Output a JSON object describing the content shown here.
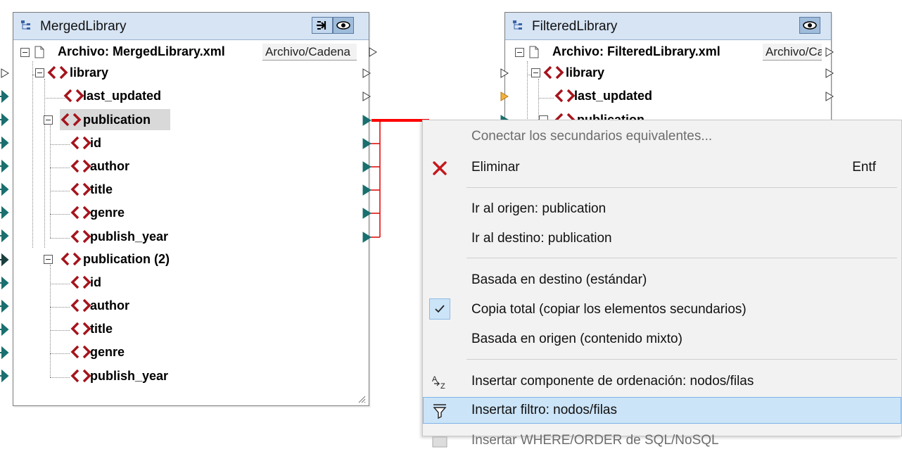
{
  "left_component": {
    "title": "MergedLibrary",
    "file_label": "Archivo: MergedLibrary.xml",
    "mode_label": "Archivo/Cadena",
    "nodes": [
      {
        "label": "library"
      },
      {
        "label": "last_updated"
      },
      {
        "label": "publication"
      },
      {
        "label": "id"
      },
      {
        "label": "author"
      },
      {
        "label": "title"
      },
      {
        "label": "genre"
      },
      {
        "label": "publish_year"
      },
      {
        "label": "publication (2)"
      },
      {
        "label": "id"
      },
      {
        "label": "author"
      },
      {
        "label": "title"
      },
      {
        "label": "genre"
      },
      {
        "label": "publish_year"
      }
    ]
  },
  "right_component": {
    "title": "FilteredLibrary",
    "file_label": "Archivo: FilteredLibrary.xml",
    "mode_label": "Archivo/Cadena",
    "nodes": [
      {
        "label": "library"
      },
      {
        "label": "last_updated"
      },
      {
        "label": "publication"
      }
    ]
  },
  "connection_color": "#ff0000",
  "menu": {
    "items": {
      "connect_children": "Conectar los secundarios equivalentes...",
      "delete": "Eliminar",
      "delete_shortcut": "Entf",
      "goto_source": "Ir al origen: publication",
      "goto_target": "Ir al destino: publication",
      "target_driven": "Basada en destino (estándar)",
      "copy_all": "Copia total (copiar los elementos secundarios)",
      "source_driven": "Basada en origen (contenido mixto)",
      "insert_sort": "Insertar componente de ordenación: nodos/filas",
      "insert_filter": "Insertar filtro: nodos/filas",
      "insert_sql": "Insertar WHERE/ORDER de SQL/NoSQL"
    },
    "icons": {
      "delete": "red-x-icon",
      "copy_all": "checkmark-icon",
      "insert_sort": "sort-az-icon",
      "insert_filter": "filter-funnel-icon",
      "insert_sql": "sql-icon"
    },
    "highlight_color": "#cce4f7"
  }
}
